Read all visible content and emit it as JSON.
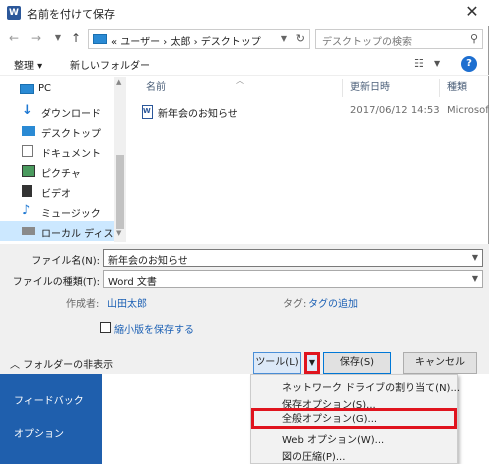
{
  "window": {
    "title": "名前を付けて保存",
    "app_icon": "W",
    "close": "✕"
  },
  "address": {
    "crumbs": "« ユーザー › 太郎 › デスクトップ",
    "search_placeholder": "デスクトップの検索"
  },
  "toolbar": {
    "organize": "整理 ▾",
    "new_folder": "新しいフォルダー",
    "help": "?"
  },
  "nav": {
    "items": [
      {
        "label": "PC"
      },
      {
        "label": "ダウンロード"
      },
      {
        "label": "デスクトップ"
      },
      {
        "label": "ドキュメント"
      },
      {
        "label": "ピクチャ"
      },
      {
        "label": "ビデオ"
      },
      {
        "label": "ミュージック"
      },
      {
        "label": "ローカル ディスク (C"
      }
    ]
  },
  "filelist": {
    "columns": {
      "name": "名前",
      "date": "更新日時",
      "type": "種類"
    },
    "rows": [
      {
        "name": "新年会のお知らせ",
        "date": "2017/06/12 14:53",
        "type": "Microsoft"
      }
    ]
  },
  "form": {
    "filename_label": "ファイル名(N):",
    "filename_value": "新年会のお知らせ",
    "filetype_label": "ファイルの種類(T):",
    "filetype_value": "Word 文書",
    "author_label": "作成者:",
    "author_value": "山田太郎",
    "tag_label": "タグ:",
    "tag_value": "タグの追加",
    "thumbnail_label": "縮小版を保存する"
  },
  "footer": {
    "hide_folders": "フォルダーの非表示",
    "tools": "ツール(L)",
    "save": "保存(S)",
    "cancel": "キャンセル"
  },
  "tools_menu": {
    "items": [
      "ネットワーク ドライブの割り当て(N)...",
      "保存オプション(S)...",
      "全般オプション(G)...",
      "Web オプション(W)...",
      "図の圧縮(P)..."
    ]
  },
  "backstage": {
    "items": [
      "フィードバック",
      "オプション"
    ]
  },
  "colors": {
    "highlight": "#e0141e",
    "link": "#1a5fb4",
    "backstage": "#1f5fad",
    "selection": "#cce8ff"
  }
}
